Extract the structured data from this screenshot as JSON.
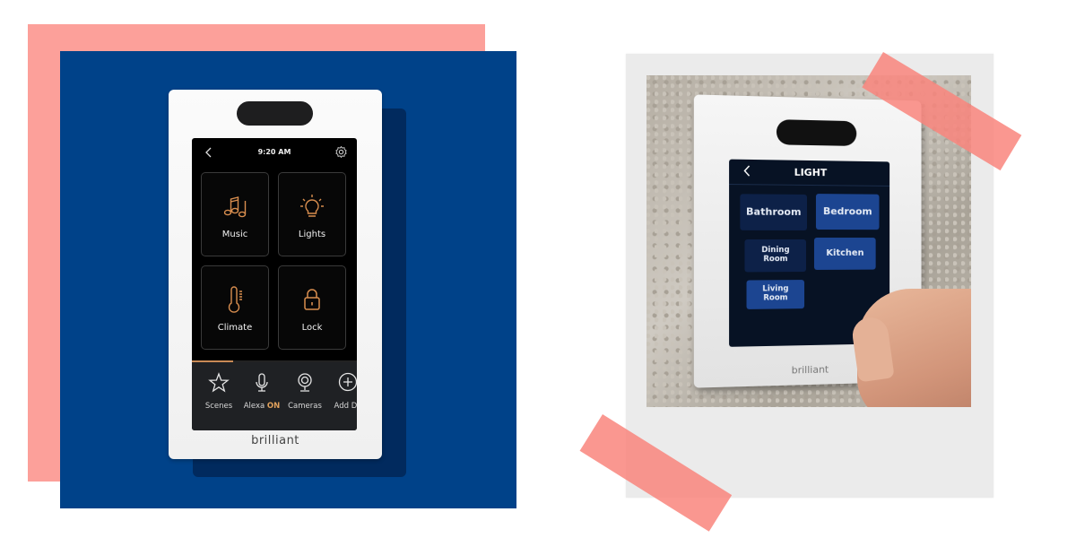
{
  "left_device": {
    "status_bar": {
      "time": "9:20 AM",
      "back_icon": "chevron-left-icon",
      "settings_icon": "gear-icon"
    },
    "tiles": [
      {
        "label": "Music",
        "icon": "music-notes-icon"
      },
      {
        "label": "Lights",
        "icon": "light-bulb-icon"
      },
      {
        "label": "Climate",
        "icon": "thermometer-icon"
      },
      {
        "label": "Lock",
        "icon": "padlock-icon"
      }
    ],
    "page_progress": 0.25,
    "dock": [
      {
        "label": "Scenes",
        "icon": "star-icon"
      },
      {
        "label": "Alexa",
        "badge": "ON",
        "icon": "microphone-icon"
      },
      {
        "label": "Cameras",
        "icon": "camera-icon"
      },
      {
        "label": "Add De",
        "icon": "plus-circle-icon"
      }
    ],
    "brand": "brilliant"
  },
  "right_device": {
    "title": "LIGHT",
    "back_icon": "chevron-left-icon",
    "rooms": [
      {
        "label": "Bathroom",
        "state": "dim"
      },
      {
        "label": "Bedroom",
        "state": "lit"
      },
      {
        "label": "Dining Room",
        "state": "dim"
      },
      {
        "label": "Kitchen",
        "state": "lit"
      },
      {
        "label": "Living Room",
        "state": "lit"
      }
    ],
    "brand": "brilliant"
  },
  "colors": {
    "pink": "#fca09a",
    "blue": "#004289",
    "accent_orange": "#c98a55",
    "room_dim": "#0d2148",
    "room_lit": "#1c4591"
  }
}
